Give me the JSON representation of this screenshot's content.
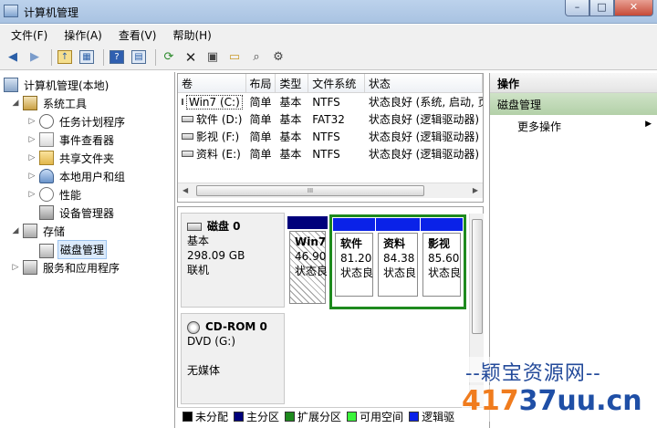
{
  "window": {
    "title": "计算机管理",
    "controls": [
      "–",
      "□",
      "✕"
    ]
  },
  "menu": [
    "文件(F)",
    "操作(A)",
    "查看(V)",
    "帮助(H)"
  ],
  "toolbar": {
    "icons": [
      "back-icon",
      "forward-icon",
      "up-icon",
      "show-tree-icon",
      "help-icon",
      "properties-icon",
      "refresh-icon",
      "delete-icon",
      "properties-sheet-icon",
      "open-folder-icon",
      "search-icon",
      "settings-icon"
    ]
  },
  "tree": {
    "root": "计算机管理(本地)",
    "system_tools": "系统工具",
    "task_scheduler": "任务计划程序",
    "event_viewer": "事件查看器",
    "shared_folders": "共享文件夹",
    "local_users": "本地用户和组",
    "performance": "性能",
    "device_manager": "设备管理器",
    "storage": "存储",
    "disk_management": "磁盘管理",
    "services": "服务和应用程序"
  },
  "volume_table": {
    "headers": [
      "卷",
      "布局",
      "类型",
      "文件系统",
      "状态"
    ],
    "rows": [
      {
        "volume": "Win7 (C:)",
        "layout": "简单",
        "type": "基本",
        "fs": "NTFS",
        "status": "状态良好 (系统, 启动, 页"
      },
      {
        "volume": "软件 (D:)",
        "layout": "简单",
        "type": "基本",
        "fs": "FAT32",
        "status": "状态良好 (逻辑驱动器)"
      },
      {
        "volume": "影视 (F:)",
        "layout": "简单",
        "type": "基本",
        "fs": "NTFS",
        "status": "状态良好 (逻辑驱动器)"
      },
      {
        "volume": "资料 (E:)",
        "layout": "简单",
        "type": "基本",
        "fs": "NTFS",
        "status": "状态良好 (逻辑驱动器)"
      }
    ]
  },
  "disk0": {
    "name": "磁盘 0",
    "type": "基本",
    "size": "298.09 GB",
    "state": "联机",
    "partitions": [
      {
        "name": "Win7",
        "size": "46.90",
        "status": "状态良"
      },
      {
        "name": "软件",
        "size": "81.20",
        "status": "状态良"
      },
      {
        "name": "资料",
        "size": "84.38",
        "status": "状态良"
      },
      {
        "name": "影视",
        "size": "85.60",
        "status": "状态良"
      }
    ]
  },
  "cdrom0": {
    "name": "CD-ROM 0",
    "drive": "DVD (G:)",
    "media": "无媒体"
  },
  "legend": [
    {
      "label": "未分配",
      "color": "#000000"
    },
    {
      "label": "主分区",
      "color": "#00007b"
    },
    {
      "label": "扩展分区",
      "color": "#1e8a1e"
    },
    {
      "label": "可用空间",
      "color": "#3bf53b"
    },
    {
      "label": "逻辑驱",
      "color": "#0a22e8"
    }
  ],
  "actions": {
    "header": "操作",
    "section": "磁盘管理",
    "more": "更多操作"
  },
  "watermark": {
    "line1": "--颖宝资源网--",
    "line2a": "417",
    "line2b": "37uu.cn"
  }
}
